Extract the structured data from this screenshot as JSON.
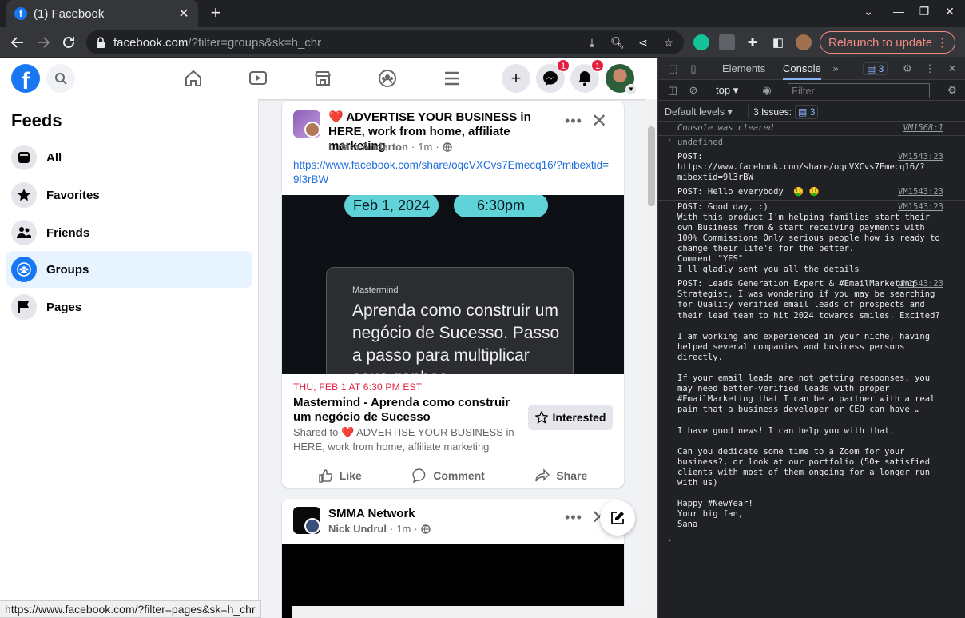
{
  "browser": {
    "tab_title": "(1) Facebook",
    "url_host": "facebook.com",
    "url_path": "/?filter=groups&sk=h_chr",
    "relaunch_label": "Relaunch to update",
    "status_url": "https://www.facebook.com/?filter=pages&sk=h_chr"
  },
  "facebook": {
    "notifications": {
      "messenger_count": "1",
      "bell_count": "1"
    },
    "sidebar": {
      "title": "Feeds",
      "items": [
        {
          "label": "All",
          "icon": "feed-icon"
        },
        {
          "label": "Favorites",
          "icon": "star-icon"
        },
        {
          "label": "Friends",
          "icon": "friends-icon"
        },
        {
          "label": "Groups",
          "icon": "groups-icon",
          "active": true
        },
        {
          "label": "Pages",
          "icon": "flag-icon"
        }
      ]
    },
    "post1": {
      "heart": "❤️",
      "title": "ADVERTISE YOUR BUSINESS in HERE, work from home, affiliate marketing",
      "author": "Luiara Anderton",
      "time": "1m",
      "link": "https://www.facebook.com/share/oqcVXCvs7Emecq16/?mibextid=9l3rBW",
      "image": {
        "date_pill": "Feb 1, 2024",
        "time_pill": "6:30pm",
        "brand": "Mastermind",
        "headline": "Aprenda como construir um negócio de Sucesso. Passo a passo para multiplicar seus ganhos"
      },
      "event_date": "THU, FEB 1 AT 6:30 PM EST",
      "event_title": "Mastermind - Aprenda como construir um negócio de Sucesso",
      "shared_to_prefix": "Shared to",
      "shared_to_group": "ADVERTISE YOUR BUSINESS in HERE, work from home, affiliate marketing",
      "interested_label": "Interested",
      "actions": {
        "like": "Like",
        "comment": "Comment",
        "share": "Share"
      }
    },
    "post2": {
      "group": "SMMA Network",
      "author": "Nick Undrul",
      "time": "1m"
    }
  },
  "devtools": {
    "tabs": [
      "Elements",
      "Console"
    ],
    "active_tab": "Console",
    "issues_badge": "3",
    "context": "top",
    "filter_placeholder": "Filter",
    "levels": "Default levels",
    "issues_label": "3 Issues:",
    "issues_count": "3",
    "console": [
      {
        "type": "info",
        "text": "Console was cleared",
        "src": "VM1568:1"
      },
      {
        "type": "ret",
        "text": "undefined",
        "src": ""
      },
      {
        "type": "log",
        "text": "POST: https://www.facebook.com/share/oqcVXCvs7Emecq16/?mibextid=9l3rBW",
        "src": "VM1543:23"
      },
      {
        "type": "log",
        "text": "POST: Hello everybody  🤑 🤑",
        "src": "VM1543:23"
      },
      {
        "type": "log",
        "text": "POST: Good day, :)\nWith this product I'm helping families start their own Business from & start receiving payments with 100% Commissions Only serious people how is ready to change their life's for the better.\nComment \"YES\"\nI'll gladly sent you all the details",
        "src": "VM1543:23"
      },
      {
        "type": "log",
        "text": "POST: Leads Generation Expert & #EmailMarketing Strategist, I was wondering if you may be searching for Quality verified email leads of prospects and their lead team to hit 2024 towards smiles. Excited?\n\nI am working and experienced in your niche, having helped several companies and business persons directly.\n\nIf your email leads are not getting responses, you may need better-verified leads with proper #EmailMarketing that I can be a partner with a real pain that a business developer or CEO can have …\n\nI have good news! I can help you with that.\n\nCan you dedicate some time to a Zoom for your business?, or look at our portfolio (50+ satisfied clients with most of them ongoing for a longer run with us)\n\nHappy #NewYear!\nYour big fan,\nSana",
        "src": "VM1543:23"
      }
    ]
  }
}
